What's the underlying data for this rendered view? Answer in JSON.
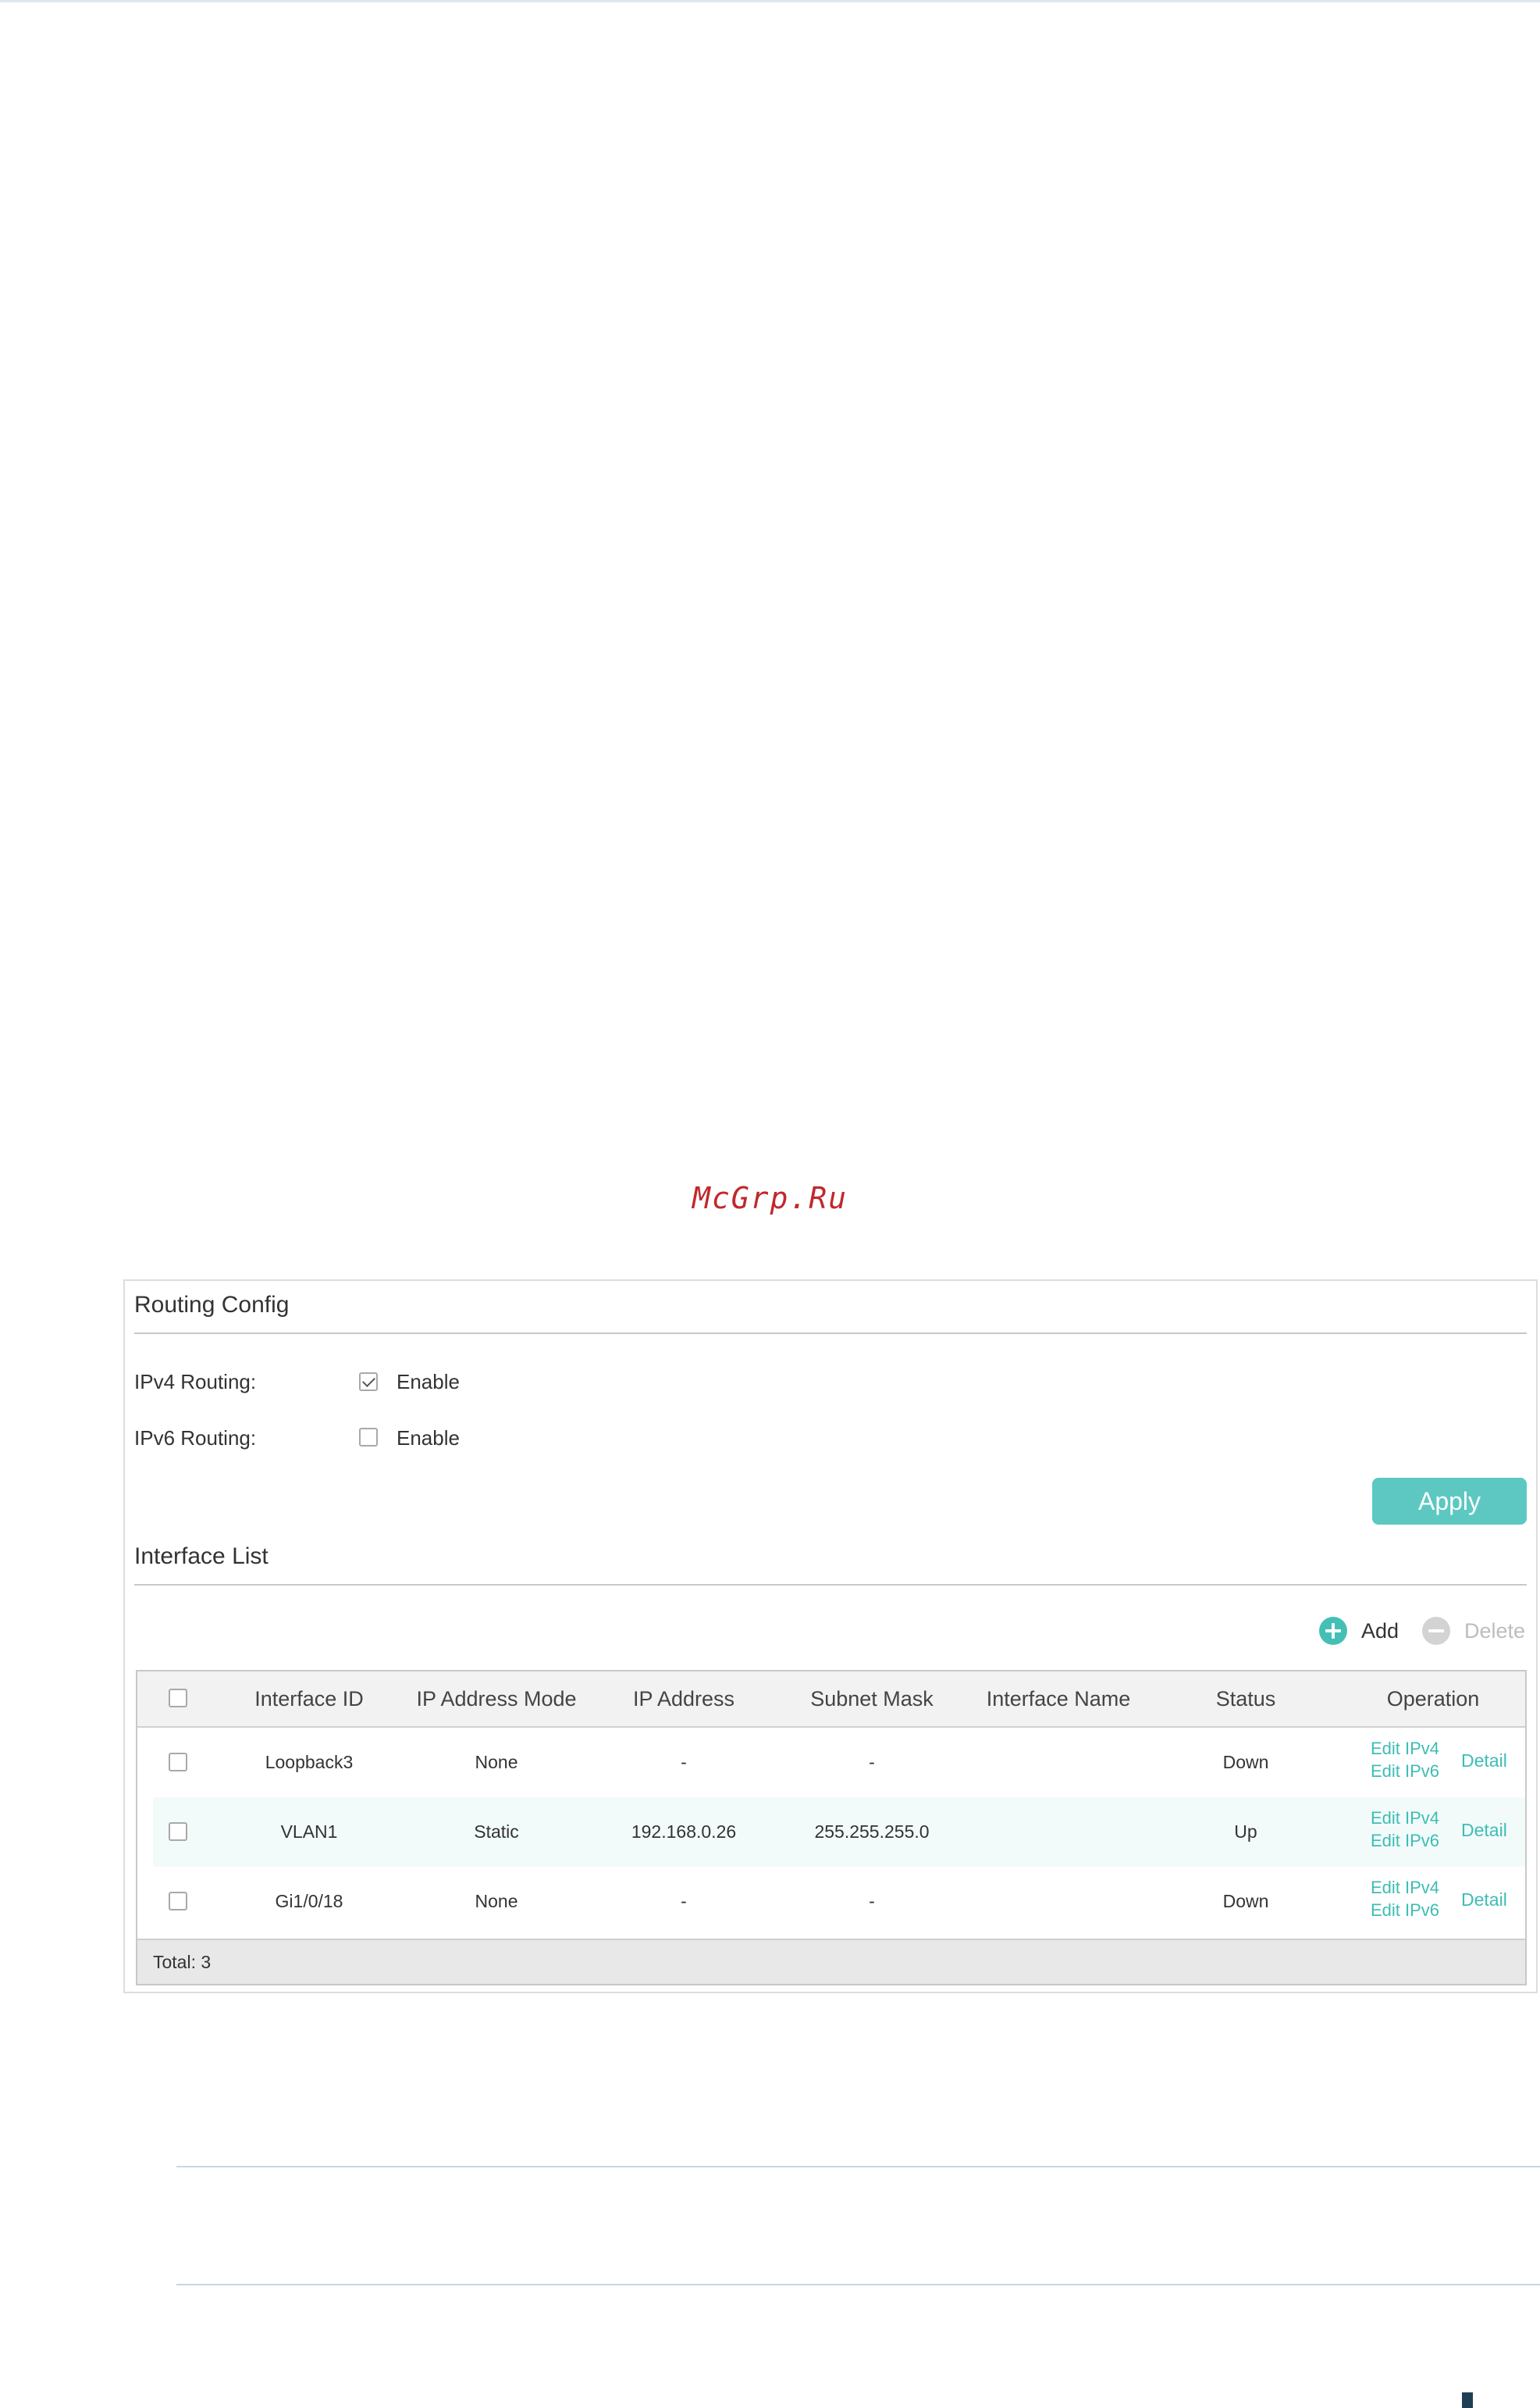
{
  "watermark": "McGrp.Ru",
  "routing_config": {
    "title": "Routing Config",
    "ipv4": {
      "label": "IPv4 Routing:",
      "option": "Enable",
      "checked": true
    },
    "ipv6": {
      "label": "IPv6 Routing:",
      "option": "Enable",
      "checked": false
    },
    "apply_label": "Apply"
  },
  "interface_list": {
    "title": "Interface List",
    "add_label": "Add",
    "delete_label": "Delete",
    "columns": [
      "Interface ID",
      "IP Address Mode",
      "IP Address",
      "Subnet Mask",
      "Interface Name",
      "Status",
      "Operation"
    ],
    "rows": [
      {
        "interface_id": "Loopback3",
        "mode": "None",
        "ip": "-",
        "mask": "-",
        "name": "",
        "status": "Down"
      },
      {
        "interface_id": "VLAN1",
        "mode": "Static",
        "ip": "192.168.0.26",
        "mask": "255.255.255.0",
        "name": "",
        "status": "Up"
      },
      {
        "interface_id": "Gi1/0/18",
        "mode": "None",
        "ip": "-",
        "mask": "-",
        "name": "",
        "status": "Down"
      }
    ],
    "operations": {
      "edit_ipv4": "Edit IPv4",
      "edit_ipv6": "Edit IPv6",
      "detail": "Detail"
    },
    "total": "Total: 3"
  },
  "colors": {
    "accent": "#44bfb6",
    "apply_button": "#5dc8c2",
    "watermark": "#c0282d"
  }
}
